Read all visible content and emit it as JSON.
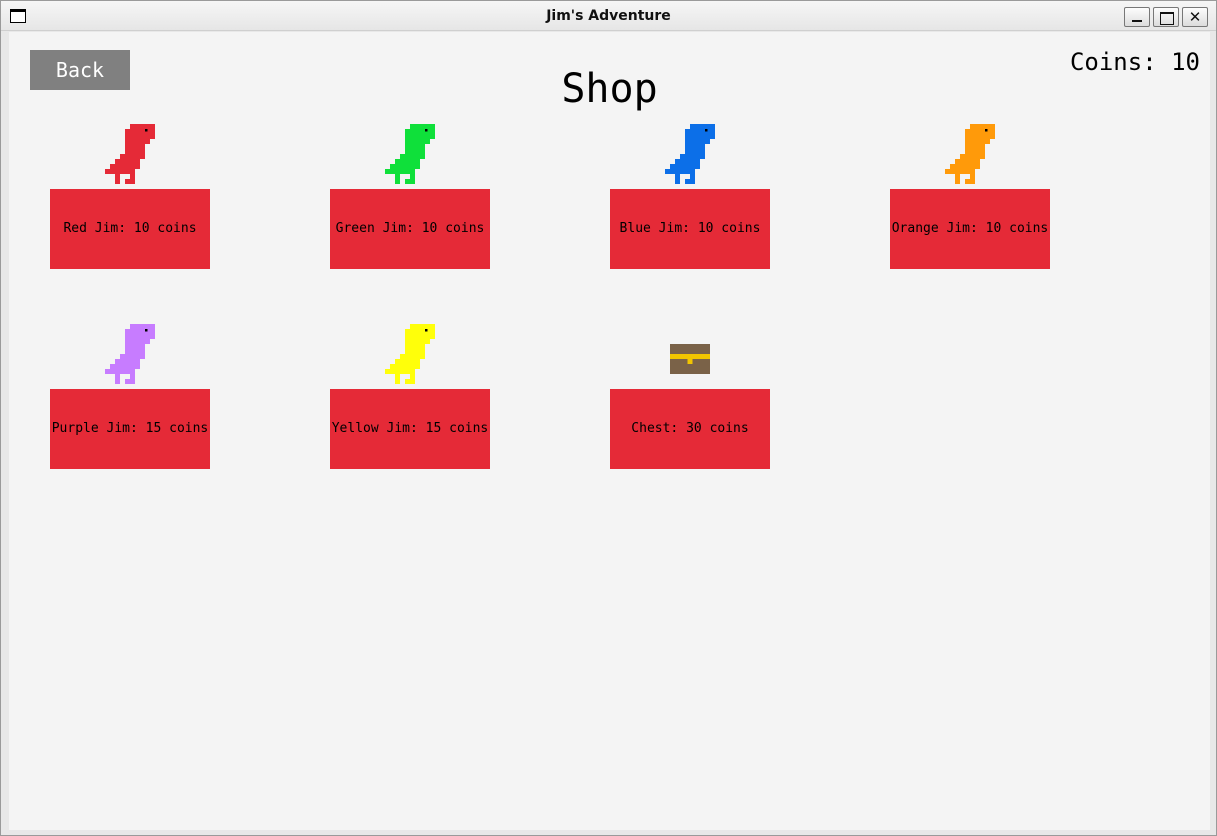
{
  "window": {
    "title": "Jim's Adventure",
    "close_glyph": "✕"
  },
  "game": {
    "back_label": "Back",
    "title": "Shop",
    "coins_text": "Coins: 10",
    "items": [
      {
        "label": "Red Jim: 10 coins",
        "color": "#e52a37",
        "icon": "dino-icon"
      },
      {
        "label": "Green Jim: 10 coins",
        "color": "#0fe03a",
        "icon": "dino-icon"
      },
      {
        "label": "Blue Jim: 10 coins",
        "color": "#0c6fe8",
        "icon": "dino-icon"
      },
      {
        "label": "Orange Jim: 10 coins",
        "color": "#ff9a0a",
        "icon": "dino-icon"
      },
      {
        "label": "Purple Jim: 15 coins",
        "color": "#c77cff",
        "icon": "dino-icon"
      },
      {
        "label": "Yellow Jim: 15 coins",
        "color": "#ffff0a",
        "icon": "dino-icon"
      },
      {
        "label": "Chest: 30 coins",
        "color": "#7a6248",
        "icon": "chest-icon"
      }
    ],
    "button_color": "#e52a37"
  }
}
